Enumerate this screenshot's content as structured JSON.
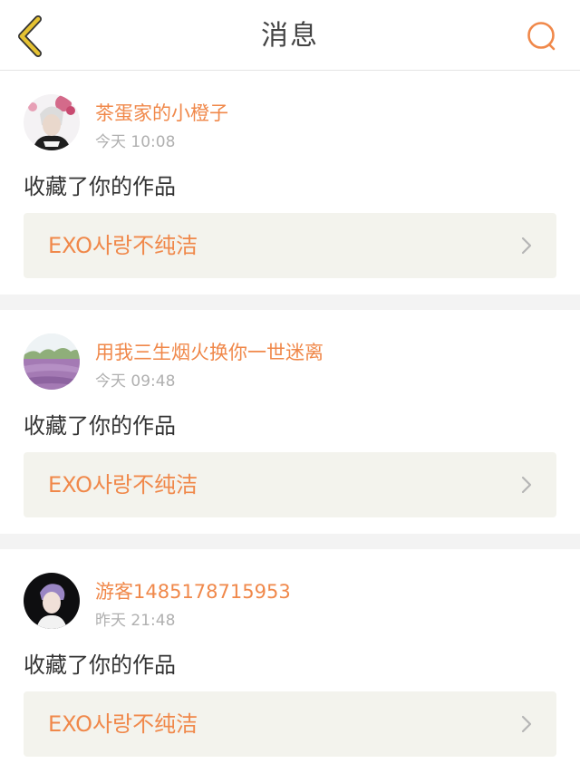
{
  "header": {
    "title": "消息",
    "back_icon": "chevron-left-icon",
    "search_icon": "search-icon",
    "accent_color": "#f0884a",
    "back_color": "#e5c232"
  },
  "messages": [
    {
      "username": "茶蛋家的小橙子",
      "time": "今天 10:08",
      "action": "收藏了你的作品",
      "work_title": "EXO사랑不纯洁",
      "avatar": "avatar-portrait-icon"
    },
    {
      "username": "用我三生烟火换你一世迷离",
      "time": "今天 09:48",
      "action": "收藏了你的作品",
      "work_title": "EXO사랑不纯洁",
      "avatar": "avatar-lavender-field-icon"
    },
    {
      "username": "游客1485178715953",
      "time": "昨天 21:48",
      "action": "收藏了你的作品",
      "work_title": "EXO사랑不纯洁",
      "avatar": "avatar-portrait-icon"
    }
  ]
}
